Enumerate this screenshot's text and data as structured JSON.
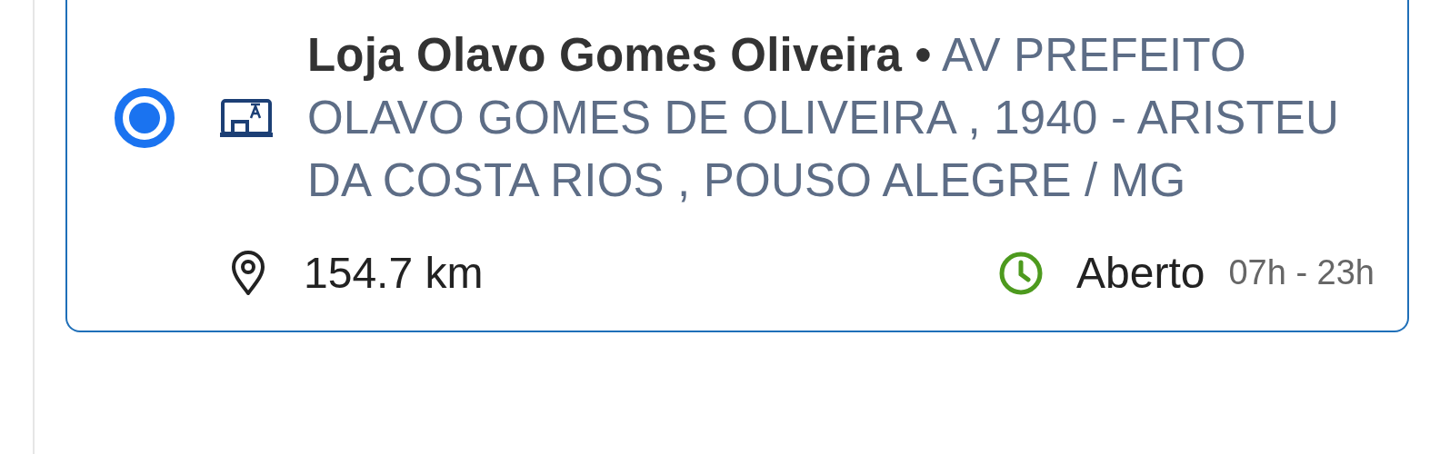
{
  "store": {
    "selected": true,
    "line": "**Loja Olavo Gomes Oliveira •**  AV PREFEITO OLAVO GOMES DE OLIVEIRA , 1940 - ARISTEU DA COSTA RIOS , POUSO ALEGRE / MG",
    "distance": "154.7 km",
    "open": true,
    "status": "Aberto",
    "hours": "07h - 23h"
  }
}
